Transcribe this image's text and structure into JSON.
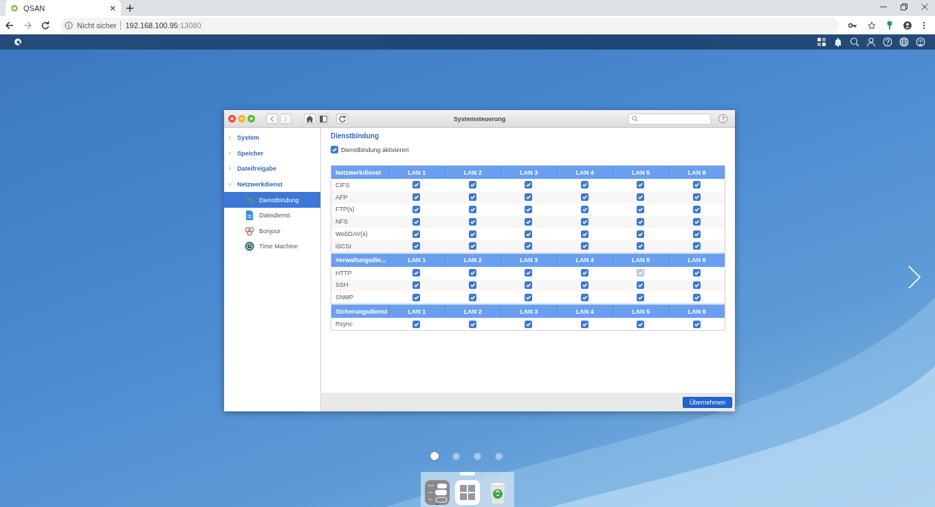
{
  "browser": {
    "tab_title": "QSAN",
    "security_label": "Nicht sicher",
    "url_host": "192.168.100.95",
    "url_port": ":13080"
  },
  "window": {
    "title": "Systemsteuerung"
  },
  "sidebar": {
    "items": [
      {
        "label": "System",
        "expanded": false,
        "selected": false
      },
      {
        "label": "Speicher",
        "expanded": false,
        "selected": false
      },
      {
        "label": "Dateifreigabe",
        "expanded": false,
        "selected": false
      },
      {
        "label": "Netzwerkdienst",
        "expanded": true,
        "selected": false,
        "children": [
          {
            "label": "Dienstbindung",
            "selected": true
          },
          {
            "label": "Dateidienst",
            "selected": false
          },
          {
            "label": "Bonjour",
            "selected": false
          },
          {
            "label": "Time Machine",
            "selected": false
          }
        ]
      }
    ]
  },
  "content": {
    "heading": "Dienstbindung",
    "enable": {
      "label": "Dienstbindung aktivieren",
      "checked": true
    }
  },
  "groups": [
    {
      "header": "Netzwerkdienst",
      "columns": [
        "LAN 1",
        "LAN 2",
        "LAN 3",
        "LAN 4",
        "LAN 5",
        "LAN 6"
      ],
      "rows": [
        {
          "name": "CIFS",
          "cells": [
            {
              "checked": true,
              "disabled": false
            },
            {
              "checked": true,
              "disabled": false
            },
            {
              "checked": true,
              "disabled": false
            },
            {
              "checked": true,
              "disabled": false
            },
            {
              "checked": true,
              "disabled": false
            },
            {
              "checked": true,
              "disabled": false
            }
          ]
        },
        {
          "name": "AFP",
          "cells": [
            {
              "checked": true,
              "disabled": false
            },
            {
              "checked": true,
              "disabled": false
            },
            {
              "checked": true,
              "disabled": false
            },
            {
              "checked": true,
              "disabled": false
            },
            {
              "checked": true,
              "disabled": false
            },
            {
              "checked": true,
              "disabled": false
            }
          ]
        },
        {
          "name": "FTP(s)",
          "cells": [
            {
              "checked": true,
              "disabled": false
            },
            {
              "checked": true,
              "disabled": false
            },
            {
              "checked": true,
              "disabled": false
            },
            {
              "checked": true,
              "disabled": false
            },
            {
              "checked": true,
              "disabled": false
            },
            {
              "checked": true,
              "disabled": false
            }
          ]
        },
        {
          "name": "NFS",
          "cells": [
            {
              "checked": true,
              "disabled": false
            },
            {
              "checked": true,
              "disabled": false
            },
            {
              "checked": true,
              "disabled": false
            },
            {
              "checked": true,
              "disabled": false
            },
            {
              "checked": true,
              "disabled": false
            },
            {
              "checked": true,
              "disabled": false
            }
          ]
        },
        {
          "name": "WebDAV(s)",
          "cells": [
            {
              "checked": true,
              "disabled": false
            },
            {
              "checked": true,
              "disabled": false
            },
            {
              "checked": true,
              "disabled": false
            },
            {
              "checked": true,
              "disabled": false
            },
            {
              "checked": true,
              "disabled": false
            },
            {
              "checked": true,
              "disabled": false
            }
          ]
        },
        {
          "name": "iSCSI",
          "cells": [
            {
              "checked": true,
              "disabled": false
            },
            {
              "checked": true,
              "disabled": false
            },
            {
              "checked": true,
              "disabled": false
            },
            {
              "checked": true,
              "disabled": false
            },
            {
              "checked": true,
              "disabled": false
            },
            {
              "checked": true,
              "disabled": false
            }
          ]
        }
      ]
    },
    {
      "header": "Verwaltungsdie...",
      "columns": [
        "LAN 1",
        "LAN 2",
        "LAN 3",
        "LAN 4",
        "LAN 5",
        "LAN 6"
      ],
      "rows": [
        {
          "name": "HTTP",
          "cells": [
            {
              "checked": true,
              "disabled": false
            },
            {
              "checked": true,
              "disabled": false
            },
            {
              "checked": true,
              "disabled": false
            },
            {
              "checked": true,
              "disabled": false
            },
            {
              "checked": true,
              "disabled": true
            },
            {
              "checked": true,
              "disabled": false
            }
          ]
        },
        {
          "name": "SSH",
          "cells": [
            {
              "checked": true,
              "disabled": false
            },
            {
              "checked": true,
              "disabled": false
            },
            {
              "checked": true,
              "disabled": false
            },
            {
              "checked": true,
              "disabled": false
            },
            {
              "checked": true,
              "disabled": false
            },
            {
              "checked": true,
              "disabled": false
            }
          ]
        },
        {
          "name": "SNMP",
          "cells": [
            {
              "checked": true,
              "disabled": false
            },
            {
              "checked": true,
              "disabled": false
            },
            {
              "checked": true,
              "disabled": false
            },
            {
              "checked": true,
              "disabled": false
            },
            {
              "checked": true,
              "disabled": false
            },
            {
              "checked": true,
              "disabled": false
            }
          ]
        }
      ]
    },
    {
      "header": "Sicherungsdienst",
      "columns": [
        "LAN 1",
        "LAN 2",
        "LAN 3",
        "LAN 4",
        "LAN 5",
        "LAN 6"
      ],
      "rows": [
        {
          "name": "Rsync",
          "cells": [
            {
              "checked": true,
              "disabled": false
            },
            {
              "checked": true,
              "disabled": false
            },
            {
              "checked": true,
              "disabled": false
            },
            {
              "checked": true,
              "disabled": false
            },
            {
              "checked": true,
              "disabled": false
            },
            {
              "checked": true,
              "disabled": false
            }
          ]
        }
      ]
    }
  ],
  "footer": {
    "apply_button": "Übernehmen"
  },
  "pager": [
    {
      "selected": true
    },
    {
      "selected": false
    },
    {
      "selected": false
    },
    {
      "selected": false
    }
  ]
}
